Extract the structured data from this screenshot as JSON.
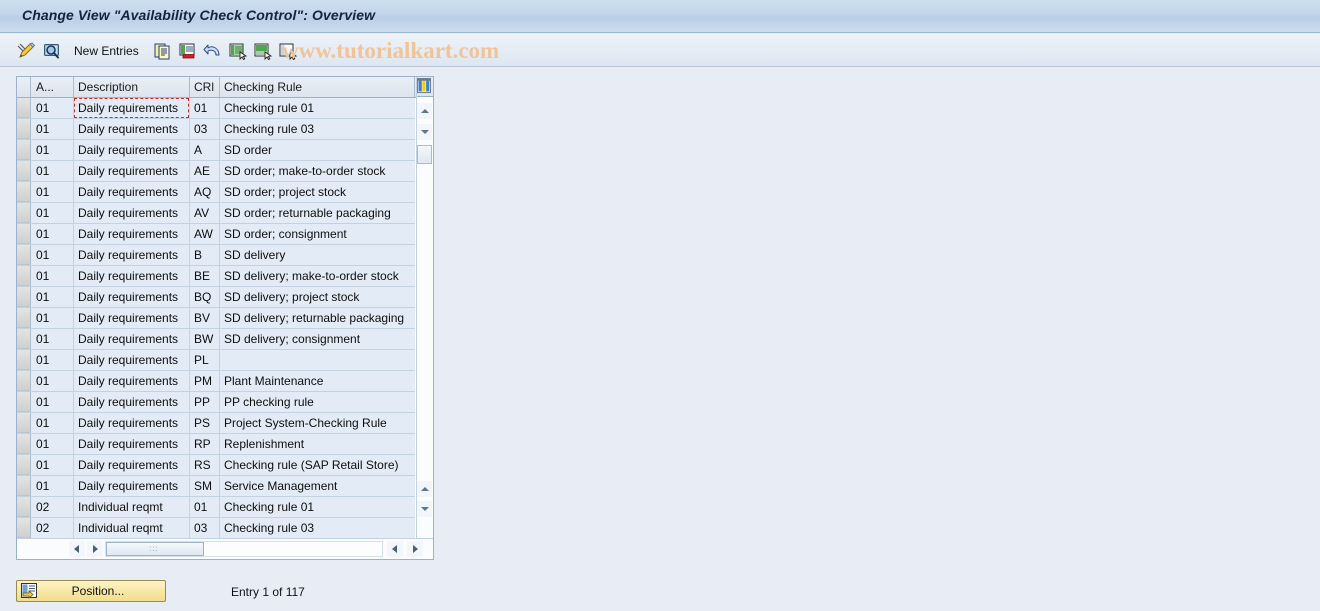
{
  "window": {
    "title": "Change View \"Availability Check Control\": Overview"
  },
  "toolbar": {
    "items": [
      {
        "name": "change-mode-icon",
        "label": "",
        "icon": "pencil-icon"
      },
      {
        "name": "display-mode-icon",
        "label": "",
        "icon": "magnifier-screen-icon"
      },
      {
        "name": "new-entries-button",
        "label": "New Entries",
        "icon": ""
      },
      {
        "name": "copy-as-button",
        "label": "",
        "icon": "copy-icon"
      },
      {
        "name": "delete-button",
        "label": "",
        "icon": "delete-row-icon"
      },
      {
        "name": "undo-button",
        "label": "",
        "icon": "undo-arrow-icon"
      },
      {
        "name": "select-all-button",
        "label": "",
        "icon": "select-all-icon"
      },
      {
        "name": "select-block-button",
        "label": "",
        "icon": "select-block-icon"
      },
      {
        "name": "deselect-all-button",
        "label": "",
        "icon": "deselect-all-icon"
      }
    ],
    "new_entries_label": "New Entries"
  },
  "watermark": {
    "text": "www.tutorialkart.com",
    "color": "#f0c49a"
  },
  "table": {
    "columns": [
      {
        "key": "avail_check",
        "header": "A..."
      },
      {
        "key": "description",
        "header": "Description"
      },
      {
        "key": "cri",
        "header": "CRl"
      },
      {
        "key": "checking_rule",
        "header": "Checking Rule"
      }
    ],
    "settings_icon": "table-settings-icon",
    "focused_cell": {
      "row": 0,
      "column": "description"
    },
    "rows": [
      {
        "avail_check": "01",
        "description": "Daily requirements",
        "cri": "01",
        "checking_rule": "Checking rule 01"
      },
      {
        "avail_check": "01",
        "description": "Daily requirements",
        "cri": "03",
        "checking_rule": "Checking rule 03"
      },
      {
        "avail_check": "01",
        "description": "Daily requirements",
        "cri": "A",
        "checking_rule": "SD order"
      },
      {
        "avail_check": "01",
        "description": "Daily requirements",
        "cri": "AE",
        "checking_rule": "SD order; make-to-order stock"
      },
      {
        "avail_check": "01",
        "description": "Daily requirements",
        "cri": "AQ",
        "checking_rule": "SD order; project stock"
      },
      {
        "avail_check": "01",
        "description": "Daily requirements",
        "cri": "AV",
        "checking_rule": "SD order; returnable packaging"
      },
      {
        "avail_check": "01",
        "description": "Daily requirements",
        "cri": "AW",
        "checking_rule": "SD order; consignment"
      },
      {
        "avail_check": "01",
        "description": "Daily requirements",
        "cri": "B",
        "checking_rule": "SD delivery"
      },
      {
        "avail_check": "01",
        "description": "Daily requirements",
        "cri": "BE",
        "checking_rule": "SD delivery; make-to-order stock"
      },
      {
        "avail_check": "01",
        "description": "Daily requirements",
        "cri": "BQ",
        "checking_rule": "SD delivery; project stock"
      },
      {
        "avail_check": "01",
        "description": "Daily requirements",
        "cri": "BV",
        "checking_rule": "SD delivery; returnable packaging"
      },
      {
        "avail_check": "01",
        "description": "Daily requirements",
        "cri": "BW",
        "checking_rule": "SD delivery; consignment"
      },
      {
        "avail_check": "01",
        "description": "Daily requirements",
        "cri": "PL",
        "checking_rule": ""
      },
      {
        "avail_check": "01",
        "description": "Daily requirements",
        "cri": "PM",
        "checking_rule": "Plant Maintenance"
      },
      {
        "avail_check": "01",
        "description": "Daily requirements",
        "cri": "PP",
        "checking_rule": "PP checking rule"
      },
      {
        "avail_check": "01",
        "description": "Daily requirements",
        "cri": "PS",
        "checking_rule": "Project System-Checking Rule"
      },
      {
        "avail_check": "01",
        "description": "Daily requirements",
        "cri": "RP",
        "checking_rule": "Replenishment"
      },
      {
        "avail_check": "01",
        "description": "Daily requirements",
        "cri": "RS",
        "checking_rule": "Checking rule (SAP Retail Store)"
      },
      {
        "avail_check": "01",
        "description": "Daily requirements",
        "cri": "SM",
        "checking_rule": "Service Management"
      },
      {
        "avail_check": "02",
        "description": "Individual reqmt",
        "cri": "01",
        "checking_rule": "Checking rule 01"
      },
      {
        "avail_check": "02",
        "description": "Individual reqmt",
        "cri": "03",
        "checking_rule": "Checking rule 03"
      }
    ]
  },
  "footer": {
    "position_label": "Position...",
    "entry_count": "Entry 1 of 117"
  }
}
